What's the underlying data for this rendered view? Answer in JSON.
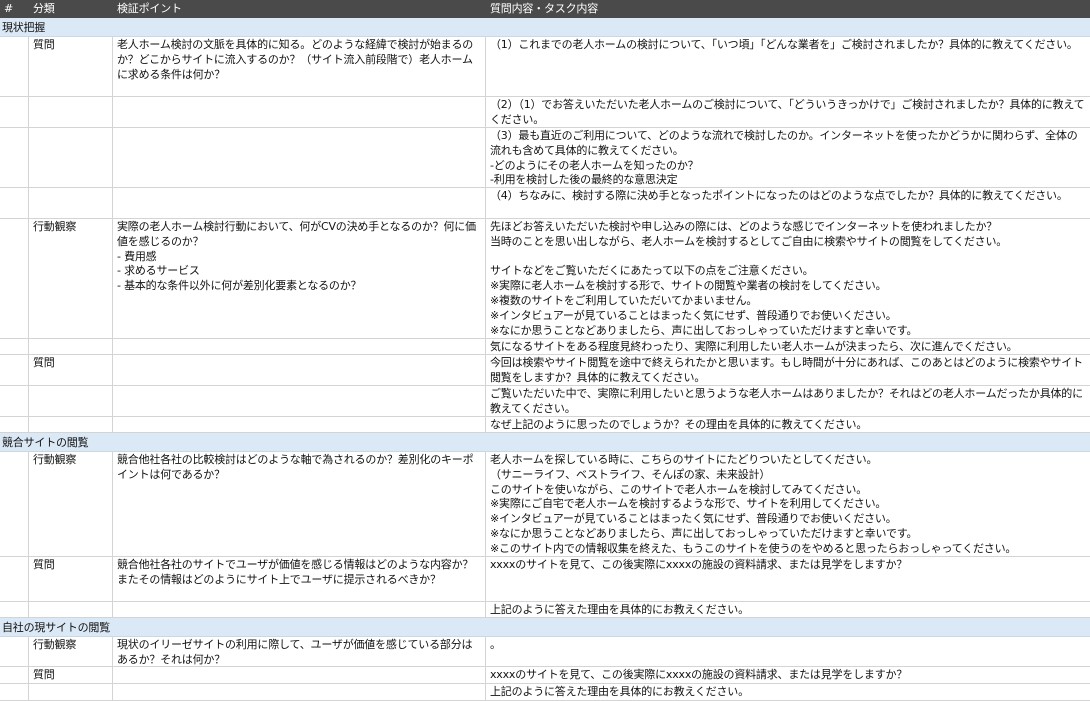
{
  "header": {
    "col0": "#",
    "col1": "分類",
    "col2": "検証ポイント",
    "col3": "質問内容・タスク内容"
  },
  "sections": [
    {
      "title": "現状把握"
    },
    {
      "title": "競合サイトの閲覧"
    },
    {
      "title": "自社の現サイトの閲覧"
    }
  ],
  "rows": [
    {
      "cat": "質問",
      "point": "老人ホーム検討の文脈を具体的に知る。どのような経緯で検討が始まるのか？どこからサイトに流入するのか？（サイト流入前段階で）老人ホームに求める条件は何か？",
      "task": "（1）これまでの老人ホームの検討について、「いつ頃」「どんな業者を」ご検討されましたか？具体的に教えてください。"
    },
    {
      "cat": "",
      "point": "",
      "task": "（2）（1）でお答えいただいた老人ホームのご検討について、「どういうきっかけで」ご検討されましたか？具体的に教えてください。"
    },
    {
      "cat": "",
      "point": "",
      "task": "（3）最も直近のご利用について、どのような流れで検討したのか。インターネットを使ったかどうかに関わらず、全体の流れも含めて具体的に教えてください。\n-どのようにその老人ホームを知ったのか？\n-利用を検討した後の最終的な意思決定"
    },
    {
      "cat": "",
      "point": "",
      "task": "（4）ちなみに、検討する際に決め手となったポイントになったのはどのような点でしたか？具体的に教えてください。"
    },
    {
      "cat": "行動観察",
      "point": "実際の老人ホーム検討行動において、何がCVの決め手となるのか？何に価値を感じるのか？\n- 費用感\n- 求めるサービス\n- 基本的な条件以外に何が差別化要素となるのか？",
      "task": "先ほどお答えいただいた検討や申し込みの際には、どのような感じでインターネットを使われましたか？\n当時のことを思い出しながら、老人ホームを検討するとしてご自由に検索やサイトの閲覧をしてください。\n\nサイトなどをご覧いただくにあたって以下の点をご注意ください。\n※実際に老人ホームを検討する形で、サイトの閲覧や業者の検討をしてください。\n※複数のサイトをご利用していただいてかまいません。\n※インタビュアーが見ていることはまったく気にせず、普段通りでお使いください。\n※なにか思うことなどありましたら、声に出しておっしゃっていただけますと幸いです。"
    },
    {
      "cat": "",
      "point": "",
      "task": "気になるサイトをある程度見終わったり、実際に利用したい老人ホームが決まったら、次に進んでください。"
    },
    {
      "cat": "質問",
      "point": "",
      "task": "今回は検索やサイト閲覧を途中で終えられたかと思います。もし時間が十分にあれば、このあとはどのように検索やサイト閲覧をしますか？具体的に教えてください。"
    },
    {
      "cat": "",
      "point": "",
      "task": "ご覧いただいた中で、実際に利用したいと思うような老人ホームはありましたか？それはどの老人ホームだったか具体的に教えてください。"
    },
    {
      "cat": "",
      "point": "",
      "task": "なぜ上記のように思ったのでしょうか？その理由を具体的に教えてください。"
    },
    {
      "cat": "行動観察",
      "point": "競合他社各社の比較検討はどのような軸で為されるのか？差別化のキーポイントは何であるか？",
      "task": "老人ホームを探している時に、こちらのサイトにたどりついたとしてください。\n（サニーライフ、ベストライフ、そんぽの家、未来設計）\nこのサイトを使いながら、このサイトで老人ホームを検討してみてください。\n※実際にご自宅で老人ホームを検討するような形で、サイトを利用してください。\n※インタビュアーが見ていることはまったく気にせず、普段通りでお使いください。\n※なにか思うことなどありましたら、声に出しておっしゃっていただけますと幸いです。\n※このサイト内での情報収集を終えた、もうこのサイトを使うのをやめると思ったらおっしゃってください。"
    },
    {
      "cat": "質問",
      "point": "競合他社各社のサイトでユーザが価値を感じる情報はどのような内容か？またその情報はどのようにサイト上でユーザに提示されるべきか？",
      "task": "xxxxのサイトを見て、この後実際にxxxxの施設の資料請求、または見学をしますか？"
    },
    {
      "cat": "",
      "point": "",
      "task": "上記のように答えた理由を具体的にお教えください。"
    },
    {
      "cat": "行動観察",
      "point": "現状のイリーゼサイトの利用に際して、ユーザが価値を感じている部分はあるか？それは何か？",
      "task": "。"
    },
    {
      "cat": "質問",
      "point": "",
      "task": "xxxxのサイトを見て、この後実際にxxxxの施設の資料請求、または見学をしますか？"
    },
    {
      "cat": "",
      "point": "",
      "task": "上記のように答えた理由を具体的にお教えください。"
    }
  ]
}
